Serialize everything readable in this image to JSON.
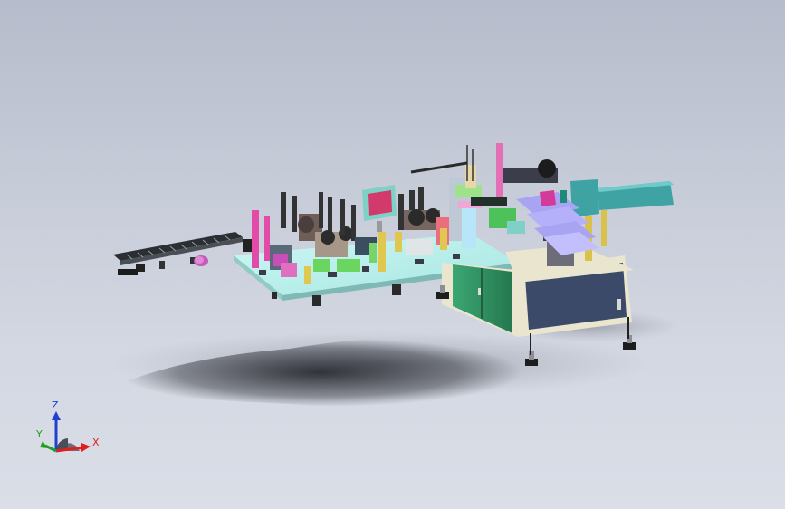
{
  "viewport": {
    "background_top": "#b6bccb",
    "background_bottom": "#dadee7"
  },
  "model": {
    "frame_color": "#2e8f62",
    "panel_color": "#3a4a68",
    "table_color": "#ebe6cd",
    "plate_color": "#bff3f0",
    "monitor_color": "#7fd0c7",
    "monitor_screen": "#d23a6b",
    "unit_color": "#3fa3a3"
  },
  "triad": {
    "x_label": "X",
    "y_label": "Y",
    "z_label": "Z",
    "x_color": "#e02020",
    "y_color": "#20a020",
    "z_color": "#2040d0",
    "icon": "coordinate-triad-icon"
  }
}
